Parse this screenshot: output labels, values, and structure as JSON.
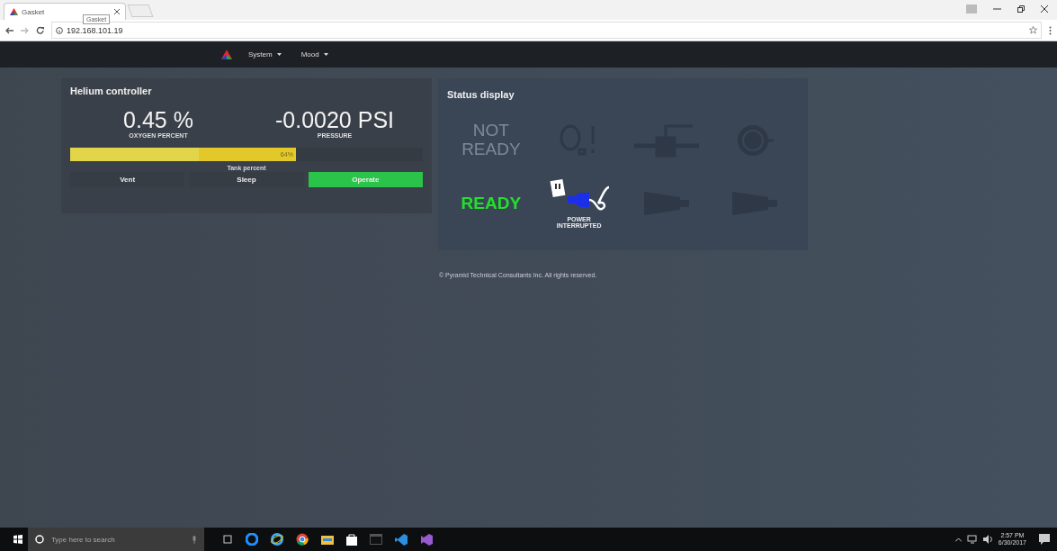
{
  "browser": {
    "tab": {
      "title": "Gasket",
      "selected": true
    },
    "tooltip": "Gasket",
    "url": "192.168.101.19"
  },
  "navbar": {
    "menus": [
      "System",
      "Mood"
    ]
  },
  "helium_controller": {
    "title": "Helium controller",
    "readings": [
      {
        "value": "0.45 %",
        "label": "OXYGEN PERCENT"
      },
      {
        "value": "-0.0020 PSI",
        "label": "PRESSURE"
      }
    ],
    "tank": {
      "level": 0.64,
      "reading": "64%",
      "label": "Tank percent"
    },
    "modes": [
      {
        "label": "Vent",
        "selected": false
      },
      {
        "label": "Sleep",
        "selected": false
      },
      {
        "label": "Operate",
        "selected": true
      }
    ]
  },
  "status_display": {
    "title": "Status display",
    "items": [
      {
        "kind": "text",
        "text": "NOT READY",
        "active": false
      },
      {
        "kind": "oxygen",
        "active": false
      },
      {
        "kind": "valve",
        "active": false
      },
      {
        "kind": "gauge",
        "active": false
      },
      {
        "kind": "text",
        "text": "READY",
        "active": true
      },
      {
        "kind": "power",
        "label": "POWER INTERRUPTED",
        "active": true
      },
      {
        "kind": "nozzle",
        "active": false
      },
      {
        "kind": "nozzle",
        "active": false
      }
    ]
  },
  "footer": "© Pyramid Technical Consultants Inc. All rights reserved.",
  "taskbar": {
    "search_placeholder": "Type here to search",
    "time": "2:57 PM",
    "date": "6/30/2017"
  }
}
